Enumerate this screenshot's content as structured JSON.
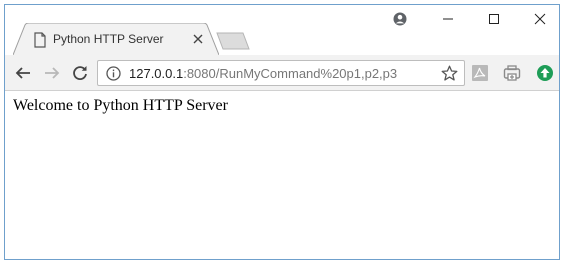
{
  "tab": {
    "title": "Python HTTP Server",
    "icon": "page-icon",
    "close_icon": "close-icon"
  },
  "window_controls": {
    "profile_icon": "profile-icon",
    "minimize_icon": "minimize-icon",
    "maximize_icon": "maximize-icon",
    "close_icon": "close-icon"
  },
  "toolbar": {
    "back_icon": "arrow-left-icon",
    "forward_icon": "arrow-right-icon",
    "reload_icon": "reload-icon",
    "info_icon": "info-icon",
    "bookmark_icon": "star-icon",
    "extensions": [
      "pdf-icon",
      "print-icon",
      "upload-icon"
    ]
  },
  "address_bar": {
    "host": "127.0.0.1",
    "rest": ":8080/RunMyCommand%20p1,p2,p3"
  },
  "page": {
    "body_text": "Welcome to Python HTTP Server"
  },
  "colors": {
    "window_border": "#6fa0cc",
    "toolbar_bg": "#f2f2f2",
    "url_host": "#222222",
    "url_rest": "#777777",
    "upload_green": "#1e9d57"
  }
}
